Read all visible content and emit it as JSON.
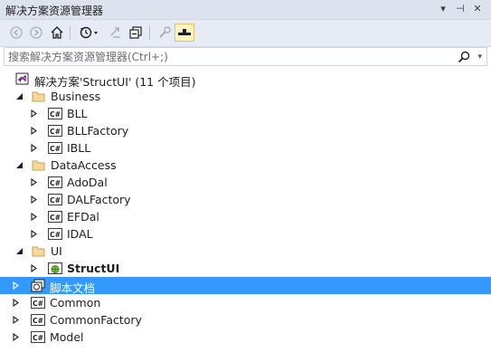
{
  "window": {
    "title": "解决方案资源管理器",
    "pin_glyph": "▾",
    "autohide_glyph": "⊣",
    "close_glyph": "✕"
  },
  "search": {
    "placeholder": "搜索解决方案资源管理器(Ctrl+;)",
    "dropdown_glyph": "▾"
  },
  "toolbar": {
    "buttons": [
      "back-icon",
      "forward-icon",
      "home-icon",
      "history-icon",
      "refresh-icon",
      "collapse-all-icon",
      "properties-icon",
      "preview-icon"
    ]
  },
  "tree": {
    "solution_label": "解决方案'StructUI' (11 个项目)",
    "business": {
      "label": "Business",
      "children": [
        "BLL",
        "BLLFactory",
        "IBLL"
      ]
    },
    "dataaccess": {
      "label": "DataAccess",
      "children": [
        "AdoDal",
        "DALFactory",
        "EFDal",
        "IDAL"
      ]
    },
    "ui": {
      "label": "UI",
      "children": [
        "StructUI"
      ]
    },
    "website_label": "脚本文档",
    "root_projects": [
      "Common",
      "CommonFactory",
      "Model"
    ]
  },
  "colors": {
    "selection": "#3399ff",
    "folder": "#dcb67a",
    "csproj_border": "#3c3c3c"
  }
}
